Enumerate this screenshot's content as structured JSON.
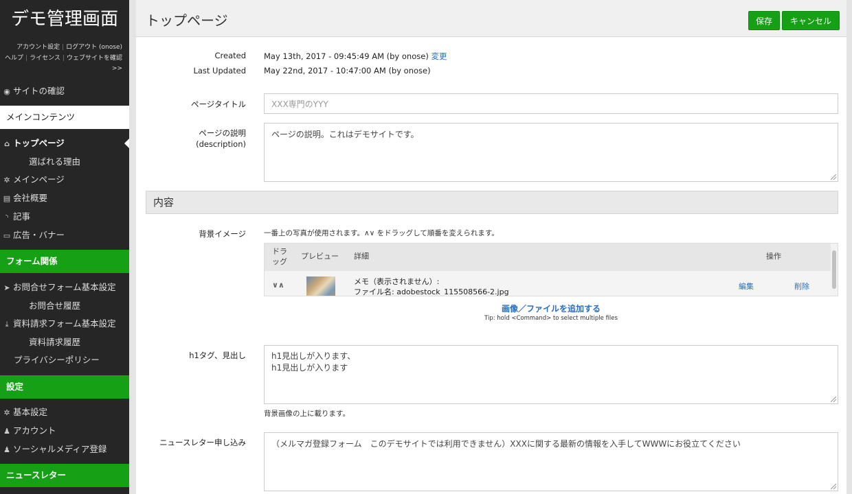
{
  "sidebar": {
    "site_title": "デモ管理画面",
    "top_links": {
      "account_settings": "アカウント設定",
      "logout": "ログアウト (onose)",
      "help": "ヘルプ",
      "license": "ライセンス",
      "view_website": "ウェブサイトを確認 >>"
    },
    "view_site": "サイトの確認",
    "main_contents_header": "メインコンテンツ",
    "main_items": [
      {
        "label": "トップページ",
        "icon": "home-icon"
      },
      {
        "label": "選ばれる理由"
      },
      {
        "label": "メインページ",
        "icon": "gear-icon"
      },
      {
        "label": "会社概要",
        "icon": "document-icon"
      },
      {
        "label": "記事",
        "icon": "rss-icon"
      },
      {
        "label": "広告・バナー",
        "icon": "banner-icon"
      }
    ],
    "forms_header": "フォーム関係",
    "form_items": [
      {
        "label": "お問合せフォーム基本設定",
        "icon": "send-icon"
      },
      {
        "label": "お問合せ履歴"
      },
      {
        "label": "資料請求フォーム基本設定",
        "icon": "download-icon"
      },
      {
        "label": "資料請求履歴"
      },
      {
        "label": "プライバシーポリシー"
      }
    ],
    "settings_header": "設定",
    "settings_items": [
      {
        "label": "基本設定",
        "icon": "gear-icon"
      },
      {
        "label": "アカウント",
        "icon": "user-icon"
      },
      {
        "label": "ソーシャルメディア登録",
        "icon": "users-icon"
      }
    ],
    "newsletter_header": "ニュースレター"
  },
  "header": {
    "title": "トップページ",
    "save_label": "保存",
    "cancel_label": "キャンセル"
  },
  "meta": {
    "created_label": "Created",
    "created_value": "May 13th, 2017 - 09:45:49 AM (by onose)",
    "change_link": "変更",
    "updated_label": "Last Updated",
    "updated_value": "May 22nd, 2017 - 10:47:00 AM (by onose)"
  },
  "form": {
    "page_title_label": "ページタイトル",
    "page_title_placeholder": "XXX専門のYYY",
    "description_label_1": "ページの説明",
    "description_label_2": "(description)",
    "description_value": "ページの説明。これはデモサイトです。",
    "content_section": "内容",
    "bg_image_label": "背景イメージ",
    "bg_image_help": "一番上の写真が使用されます。∧∨ をドラッグして順番を変えられます。",
    "image_table": {
      "col_drag_1": "ドラ",
      "col_drag_2": "ッグ",
      "col_preview": "プレビュー",
      "col_detail": "詳細",
      "col_ops": "操作",
      "row": {
        "drag_glyph": "∨∧",
        "memo": "メモ（表示されません）:",
        "filename": "ファイル名: adobestock_115508566-2.jpg",
        "edit": "編集",
        "delete": "削除"
      }
    },
    "add_image_link": "画像／ファイルを追加する",
    "add_image_tip": "Tip: hold <Command> to select multiple files",
    "h1_label": "h1タグ、見出し",
    "h1_line_1": "h1見出しが入ります、",
    "h1_line_2": "h1見出しが入ります",
    "h1_help": "背景画像の上に載ります。",
    "newsletter_label": "ニュースレター申し込み",
    "newsletter_value": "（メルマガ登録フォーム　このデモサイトでは利用できません）XXXに関する最新の情報を入手してWWWにお役立てください"
  },
  "colors": {
    "sidebar_bg": "#262626",
    "accent_green": "#16a015",
    "link_blue": "#2a6ebb"
  }
}
